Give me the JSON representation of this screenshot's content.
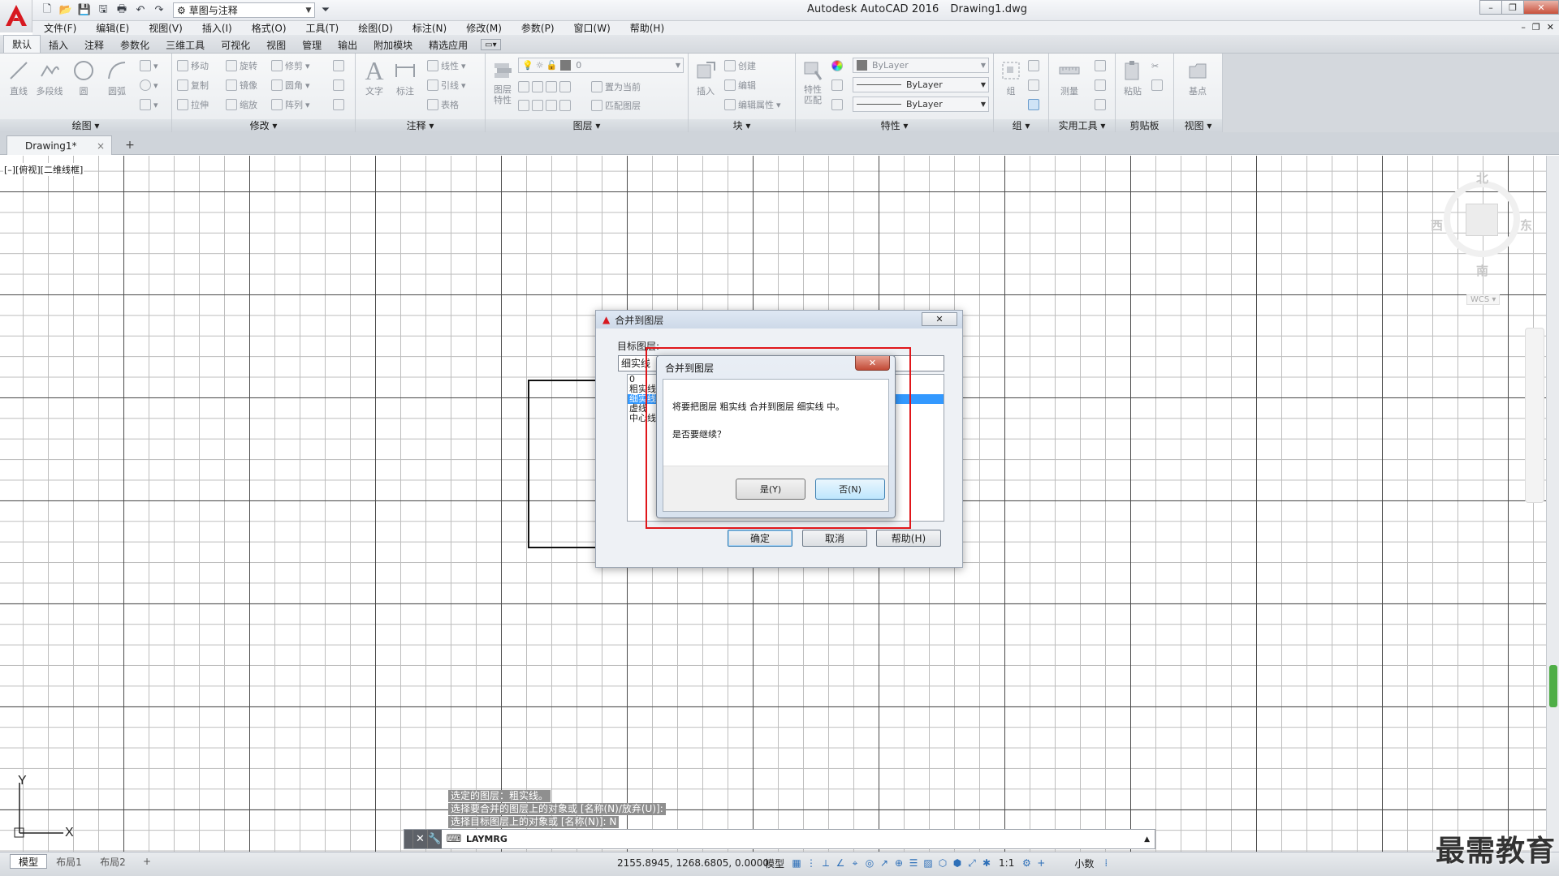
{
  "window": {
    "app_title": "Autodesk AutoCAD 2016",
    "doc_title": "Drawing1.dwg",
    "workspace": "草图与注释",
    "controls": [
      "–",
      "❐",
      "✕"
    ],
    "doc_controls": [
      "–",
      "❐",
      "✕"
    ]
  },
  "menu": [
    "文件(F)",
    "编辑(E)",
    "视图(V)",
    "插入(I)",
    "格式(O)",
    "工具(T)",
    "绘图(D)",
    "标注(N)",
    "修改(M)",
    "参数(P)",
    "窗口(W)",
    "帮助(H)"
  ],
  "ribbon_tabs": [
    "默认",
    "插入",
    "注释",
    "参数化",
    "三维工具",
    "可视化",
    "视图",
    "管理",
    "输出",
    "附加模块",
    "精选应用"
  ],
  "ribbon_extra": "▭▾",
  "ribbon": {
    "draw": {
      "title": "绘图 ▾",
      "tools": [
        "直线",
        "多段线",
        "圆",
        "圆弧"
      ]
    },
    "modify": {
      "title": "修改 ▾",
      "tools": [
        "移动",
        "旋转",
        "修剪",
        "复制",
        "镜像",
        "圆角",
        "拉伸",
        "缩放",
        "阵列"
      ]
    },
    "annotation": {
      "title": "注释 ▾",
      "tools": [
        "文字",
        "标注",
        "线性",
        "引线",
        "表格"
      ]
    },
    "layers": {
      "title": "图层 ▾",
      "tools": [
        "图层特性",
        "置为当前",
        "匹配图层"
      ],
      "current_layer": "0"
    },
    "block": {
      "title": "块 ▾",
      "tools": [
        "插入",
        "创建",
        "编辑",
        "编辑属性"
      ]
    },
    "properties": {
      "title": "特性 ▾",
      "tools": [
        "特性匹配"
      ],
      "color": "ByLayer",
      "linetype": "ByLayer",
      "lineweight": "ByLayer"
    },
    "group": {
      "title": "组 ▾",
      "tools": [
        "组"
      ]
    },
    "utilities": {
      "title": "实用工具 ▾",
      "tools": [
        "测量"
      ]
    },
    "clipboard": {
      "title": "剪贴板",
      "tools": [
        "粘贴"
      ]
    },
    "view": {
      "title": "视图 ▾",
      "tools": [
        "基点"
      ]
    }
  },
  "file_tab": {
    "label": "Drawing1*",
    "close": "×",
    "new": "+"
  },
  "viewport_label": "[–][俯视][二维线框]",
  "viewcube": {
    "north": "北",
    "south": "南",
    "east": "东",
    "west": "西",
    "wcs": "WCS ▾"
  },
  "ucs": {
    "x": "X",
    "y": "Y"
  },
  "command_history": [
    "选定的图层：粗实线。",
    "选择要合并的图层上的对象或 [名称(N)/放弃(U)]:",
    "选择目标图层上的对象或 [名称(N)]: N"
  ],
  "command_line": {
    "current": "LAYMRG",
    "close": "✕",
    "settings": "🔧",
    "expand": "▲"
  },
  "status": {
    "layout_tabs": [
      "模型",
      "布局1",
      "布局2"
    ],
    "add_layout": "+",
    "coords": "2155.8945, 1268.6805, 0.0000",
    "mode": "模型",
    "scale": "1:1",
    "units": "小数",
    "icons": [
      "▦",
      "⋮",
      "⟂",
      "∠",
      "⌖",
      "◎",
      "↗",
      "⊕",
      "☰",
      "▨",
      "⬡",
      "⬢",
      "⤢",
      "✱",
      "⚙",
      "+",
      "⁞"
    ]
  },
  "watermark": "最需教育",
  "dialog_outer": {
    "title": "合并到图层",
    "close": "✕",
    "target_label": "目标图层:",
    "target_value": "细实线",
    "layers": [
      "0",
      "粗实线",
      "细实线",
      "虚线",
      "中心线"
    ],
    "selected_index": 2,
    "buttons": [
      "确定",
      "取消",
      "帮助(H)"
    ]
  },
  "dialog_confirm": {
    "title": "合并到图层",
    "close": "✕",
    "message": "将要把图层 粗实线 合并到图层 细实线 中。",
    "question": "是否要继续？",
    "yes": "是(Y)",
    "no": "否(N)"
  },
  "colors": {
    "highlight": "#e0161a",
    "selection": "#3399ff",
    "grid_major": "#4a4a4a",
    "grid_minor": "#bdbdbd"
  }
}
